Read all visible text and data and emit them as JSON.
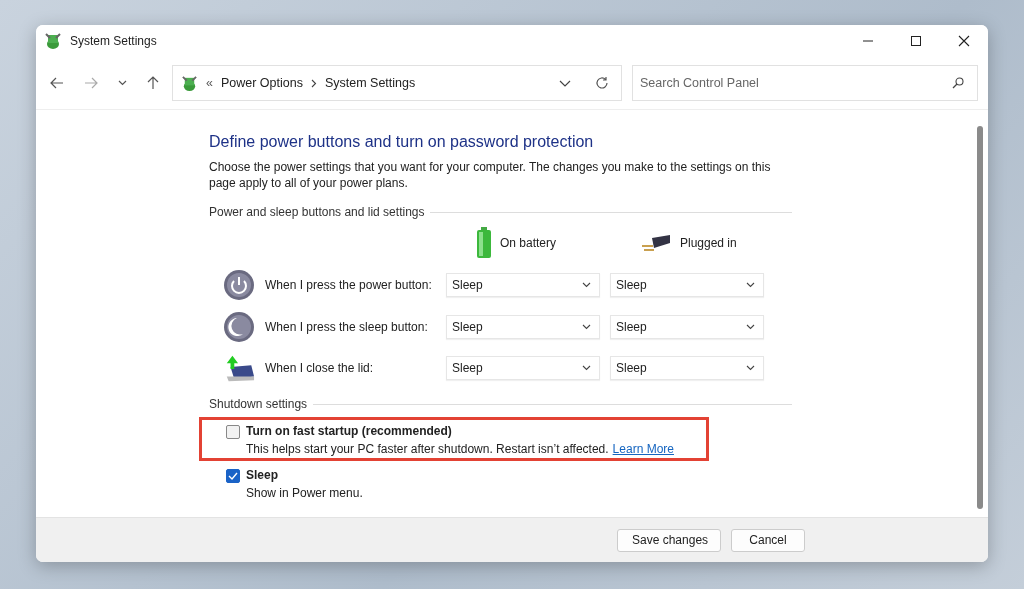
{
  "window": {
    "title": "System Settings"
  },
  "address_bar": {
    "overflow_mark": "«",
    "path": [
      "Power Options",
      "System Settings"
    ]
  },
  "search": {
    "placeholder": "Search Control Panel"
  },
  "page": {
    "heading": "Define power buttons and turn on password protection",
    "description": "Choose the power settings that you want for your computer. The changes you make to the settings on this page apply to all of your power plans.",
    "buttons_section": {
      "title": "Power and sleep buttons and lid settings",
      "columns": [
        {
          "label": "On battery",
          "kind": "battery"
        },
        {
          "label": "Plugged in",
          "kind": "plug"
        }
      ],
      "rows": [
        {
          "kind": "power",
          "label": "When I press the power button:",
          "values": [
            "Sleep",
            "Sleep"
          ]
        },
        {
          "kind": "sleep",
          "label": "When I press the sleep button:",
          "values": [
            "Sleep",
            "Sleep"
          ]
        },
        {
          "kind": "lid",
          "label": "When I close the lid:",
          "values": [
            "Sleep",
            "Sleep"
          ]
        }
      ]
    },
    "shutdown_section": {
      "title": "Shutdown settings",
      "options": [
        {
          "label": "Turn on fast startup (recommended)",
          "description": "This helps start your PC faster after shutdown. Restart isn’t affected.",
          "link": "Learn More",
          "checked": false,
          "highlighted": true
        },
        {
          "label": "Sleep",
          "description": "Show in Power menu.",
          "checked": true,
          "highlighted": false
        }
      ]
    }
  },
  "buttons": [
    "Save changes",
    "Cancel"
  ]
}
